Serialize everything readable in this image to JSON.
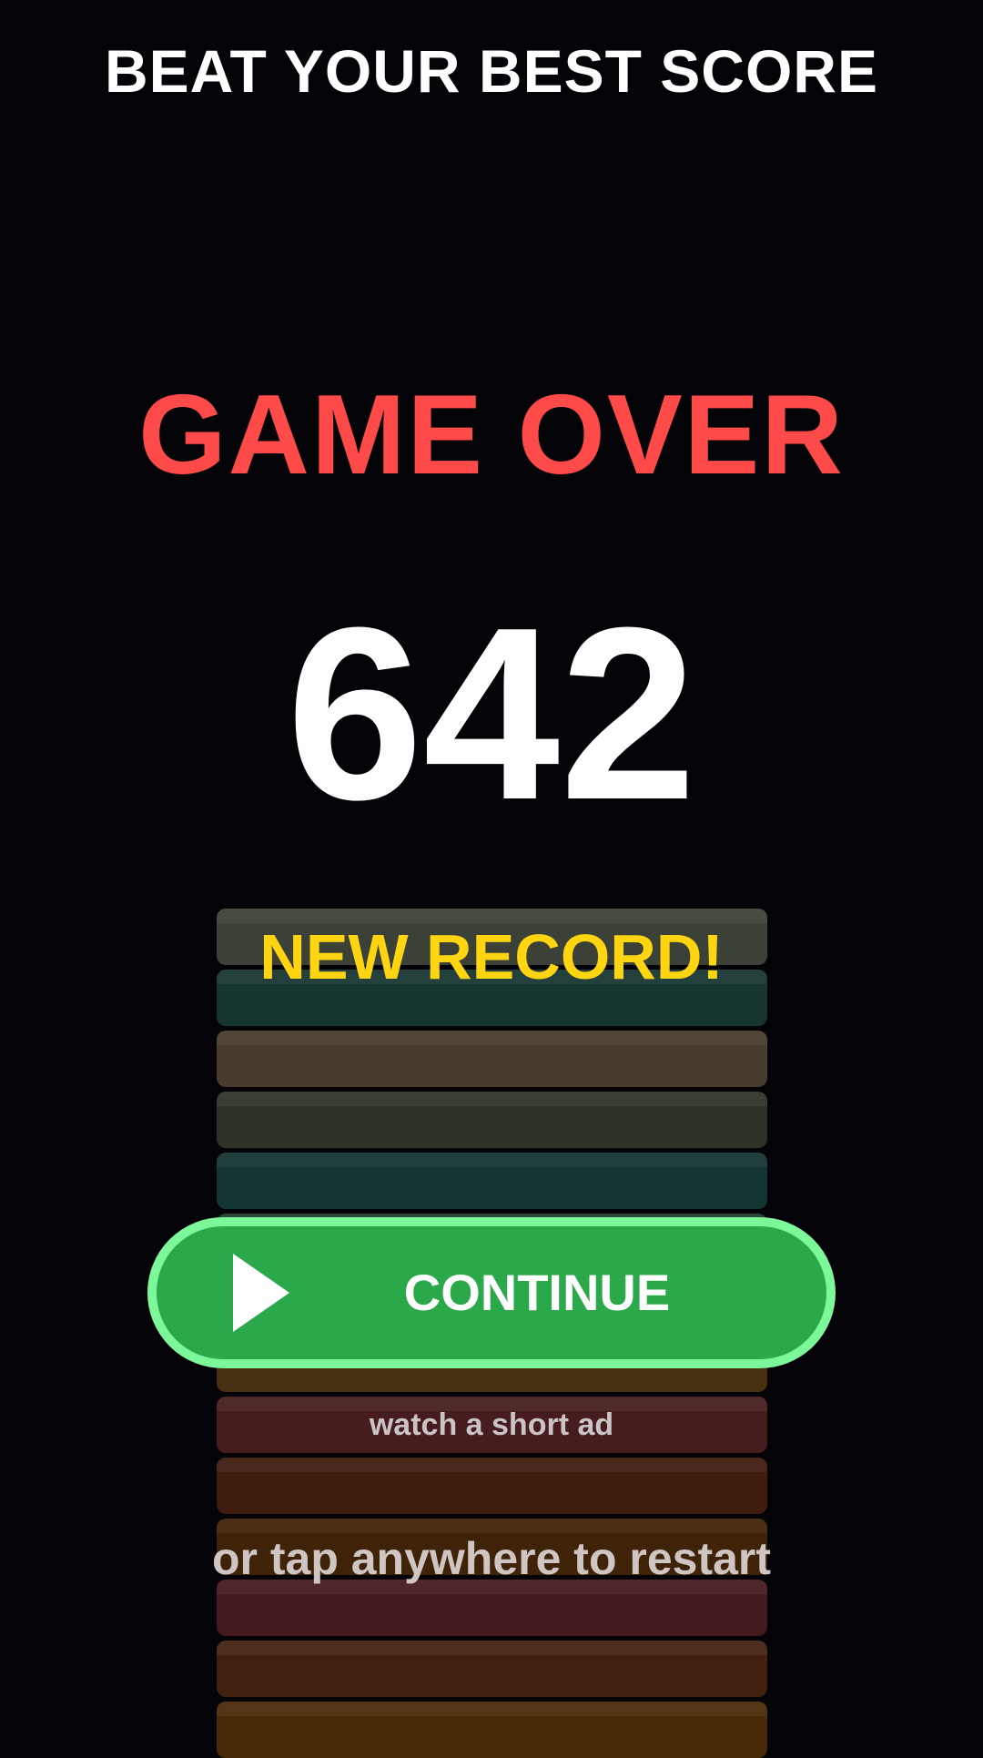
{
  "header": {
    "banner": "BEAT YOUR BEST SCORE"
  },
  "result": {
    "title": "GAME OVER",
    "title_color": "#ff4a4a",
    "score": "642",
    "record_label": "NEW RECORD!",
    "record_color": "#ffd512"
  },
  "tower": {
    "blocks": [
      "#3b4136",
      "#163530",
      "#463b2c",
      "#2e3329",
      "#133430",
      "#1c3b2c",
      "#2e2a1e",
      "#463010",
      "#461c1e",
      "#3f1c0e",
      "#3f2308",
      "#451a1e",
      "#42200f",
      "#492a08"
    ]
  },
  "actions": {
    "continue_label": "CONTINUE",
    "continue_color": "#2aa84a",
    "ad_note": "watch a short ad",
    "restart_hint": "or tap anywhere to restart"
  }
}
